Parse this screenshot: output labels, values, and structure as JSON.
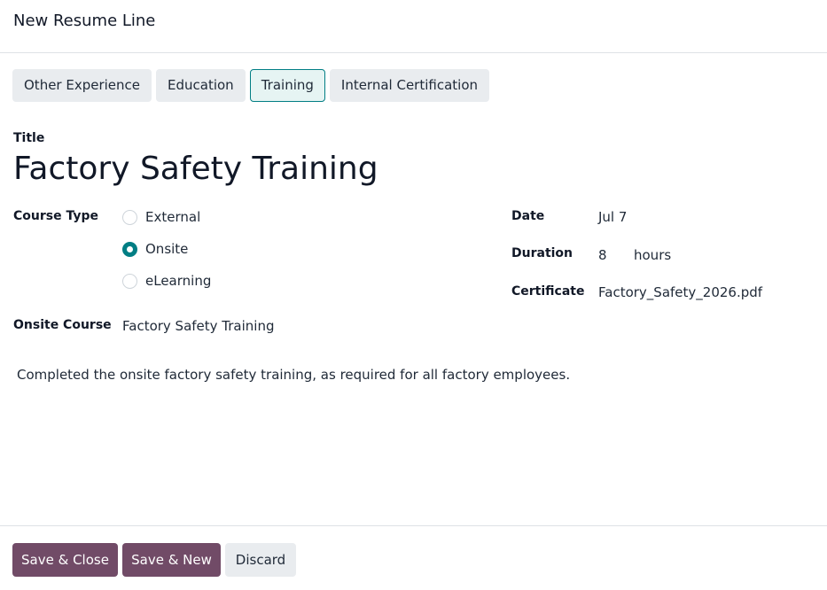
{
  "dialog": {
    "title": "New Resume Line"
  },
  "type_tabs": [
    {
      "label": "Other Experience",
      "active": false
    },
    {
      "label": "Education",
      "active": false
    },
    {
      "label": "Training",
      "active": true
    },
    {
      "label": "Internal Certification",
      "active": false
    }
  ],
  "form": {
    "title_label": "Title",
    "title_value": "Factory Safety Training",
    "course_type_label": "Course Type",
    "course_type_options": [
      {
        "label": "External",
        "checked": false
      },
      {
        "label": "Onsite",
        "checked": true
      },
      {
        "label": "eLearning",
        "checked": false
      }
    ],
    "onsite_course_label": "Onsite Course",
    "onsite_course_value": "Factory Safety Training",
    "date_label": "Date",
    "date_value": "Jul 7",
    "duration_label": "Duration",
    "duration_value": "8",
    "duration_unit": "hours",
    "certificate_label": "Certificate",
    "certificate_value": "Factory_Safety_2026.pdf",
    "description": "Completed the onsite factory safety training, as required for all factory employees."
  },
  "footer": {
    "save_close_label": "Save & Close",
    "save_new_label": "Save & New",
    "discard_label": "Discard"
  },
  "colors": {
    "primary": "#714b67",
    "accent": "#017e84",
    "secondary_bg": "#e9ecef"
  }
}
